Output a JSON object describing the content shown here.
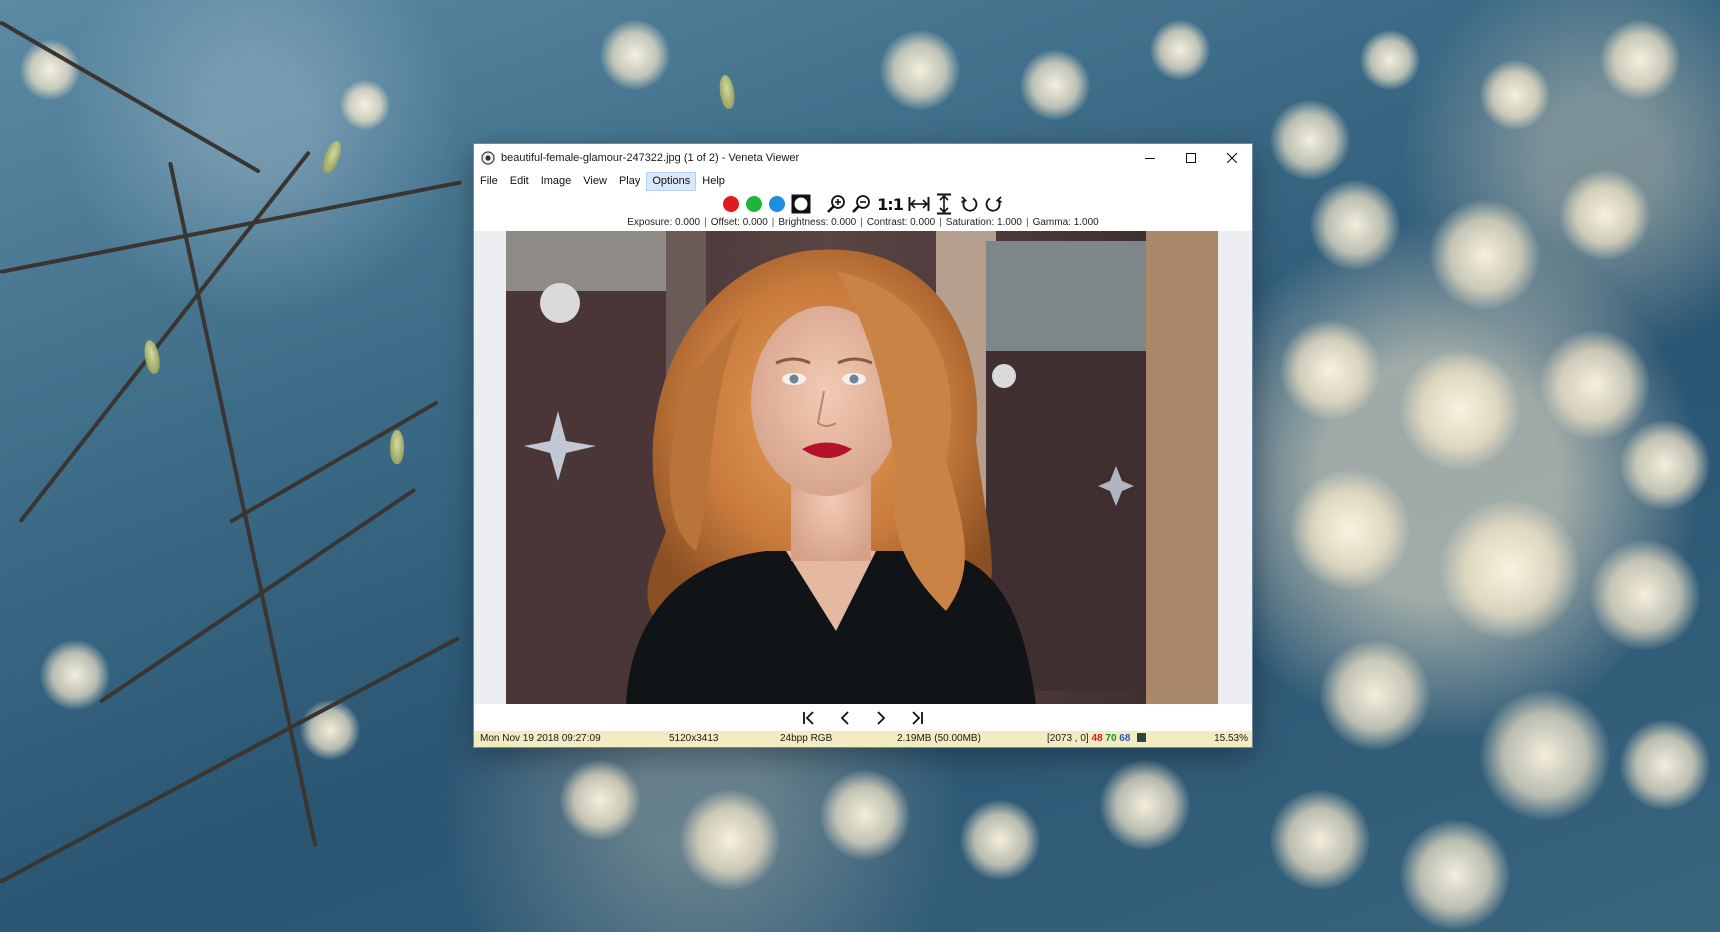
{
  "window": {
    "title": "beautiful-female-glamour-247322.jpg (1 of 2) - Veneta Viewer"
  },
  "menu": [
    "File",
    "Edit",
    "Image",
    "View",
    "Play",
    "Options",
    "Help"
  ],
  "menu_active": "Options",
  "toolbar": {
    "channel_colors": [
      "#e01b1b",
      "#1fb53a",
      "#1f8ee0"
    ],
    "ratio_label": "1:1",
    "icons": [
      "red-channel-icon",
      "green-channel-icon",
      "blue-channel-icon",
      "luminance-icon",
      "zoom-in-icon",
      "zoom-out-icon",
      "fit-width-icon",
      "fit-height-icon",
      "rotate-left-icon",
      "rotate-right-icon"
    ]
  },
  "adjust": {
    "exposure": "Exposure: 0.000",
    "offset": "Offset: 0.000",
    "brightness": "Brightness: 0.000",
    "contrast": "Contrast: 0.000",
    "saturation": "Saturation: 1.000",
    "gamma": "Gamma: 1.000"
  },
  "status": {
    "date": "Mon Nov 19 2018 09:27:09",
    "dimensions": "5120x3413",
    "format": "24bpp RGB",
    "size": "2.19MB (50.00MB)",
    "coords": "[2073 , 0]",
    "r": "48",
    "g": "70",
    "b": "68",
    "zoom": "15.53%",
    "swatch_color": "#304448"
  }
}
